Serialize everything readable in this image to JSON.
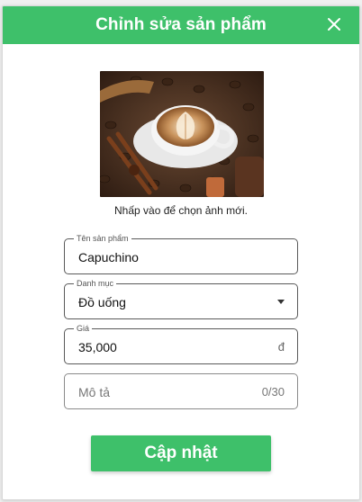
{
  "dialog": {
    "title": "Chỉnh sửa sản phẩm",
    "close_icon": "close-icon",
    "accent_color": "#3ec06a"
  },
  "image": {
    "hint": "Nhấp vào để chọn ảnh mới."
  },
  "fields": {
    "name": {
      "label": "Tên sản phẩm",
      "value": "Capuchino"
    },
    "category": {
      "label": "Danh mục",
      "value": "Đồ uống"
    },
    "price": {
      "label": "Giá",
      "value": "35,000",
      "suffix": "đ"
    },
    "description": {
      "placeholder": "Mô tả",
      "counter": "0/30"
    }
  },
  "submit": {
    "label": "Cập nhật"
  }
}
